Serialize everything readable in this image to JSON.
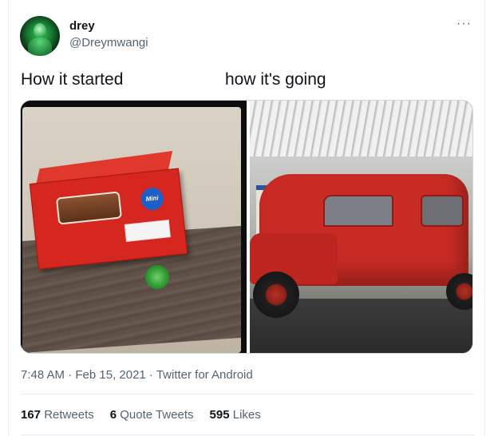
{
  "tweet": {
    "author_name": "drey",
    "author_handle": "@Dreymwangi",
    "more_icon": "more-dots-icon",
    "caption_left": "How it started",
    "caption_right": "how it's going",
    "image_left_box_label": "Mini",
    "timestamp": "7:48 AM · Feb 15, 2021 · Twitter for Android"
  },
  "stats": {
    "retweets_count": "167",
    "retweets_label": "Retweets",
    "quotes_count": "6",
    "quotes_label": "Quote Tweets",
    "likes_count": "595",
    "likes_label": "Likes"
  },
  "colors": {
    "text_primary": "#0f1419",
    "text_secondary": "#536471",
    "divider": "#ebeef0",
    "box_red": "#d5271f",
    "van_red": "#c72b24"
  }
}
